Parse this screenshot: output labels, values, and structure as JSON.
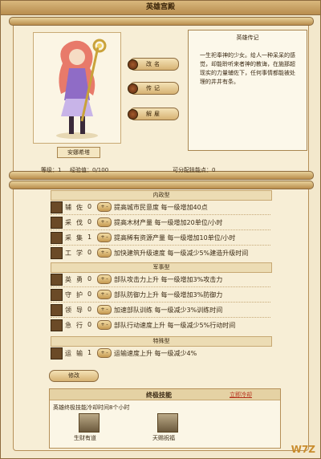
{
  "window": {
    "title": "英雄宫殿"
  },
  "hero": {
    "name": "安娜希塔",
    "level_text": "等级：1",
    "exp_text": "经验值：0/100",
    "points_text": "可分配技能点：0"
  },
  "actions": {
    "rename": "改名",
    "biography": "传记",
    "dismiss": "解雇"
  },
  "bio": {
    "title": "英雄传记",
    "text": "一生祀奉神的少女。给人一种呆呆的感觉，却能聆听来者神的教诲，在施那超现实的力量辅佐下，任何事情都能被处理的井井有条。"
  },
  "sections": {
    "internal": "内政型",
    "military": "军事型",
    "special": "特殊型"
  },
  "skills": [
    {
      "name": "辅佐",
      "level": "0",
      "desc": "提高城市民意度  每一级增加40点"
    },
    {
      "name": "采伐",
      "level": "0",
      "desc": "提高木材产量  每一级增加20单位/小时"
    },
    {
      "name": "采集",
      "level": "1",
      "desc": "提高稀有资源产量  每一级增加10单位/小时"
    },
    {
      "name": "工学",
      "level": "0",
      "desc": "加快建筑升级速度  每一级减少5%建造升级时间"
    },
    {
      "name": "英勇",
      "level": "0",
      "desc": "部队攻击力上升  每一级增加3%攻击力"
    },
    {
      "name": "守护",
      "level": "0",
      "desc": "部队防御力上升  每一级增加3%防御力"
    },
    {
      "name": "领导",
      "level": "0",
      "desc": "加速部队训练  每一级减少3%训练时间"
    },
    {
      "name": "急行",
      "level": "0",
      "desc": "部队行动速度上升  每一级减少5%行动时间"
    },
    {
      "name": "运输",
      "level": "1",
      "desc": "运输速度上升  每一级减少4%"
    }
  ],
  "plusminus": "+ -",
  "upgrade_button": "修改",
  "ultimate": {
    "title": "终极技能",
    "cooldown_link": "立即冷却",
    "note": "英雄终极技能冷却时间8个小时",
    "skill1": "生财有道",
    "skill2": "天赐祝福"
  },
  "watermark": "W7Z"
}
